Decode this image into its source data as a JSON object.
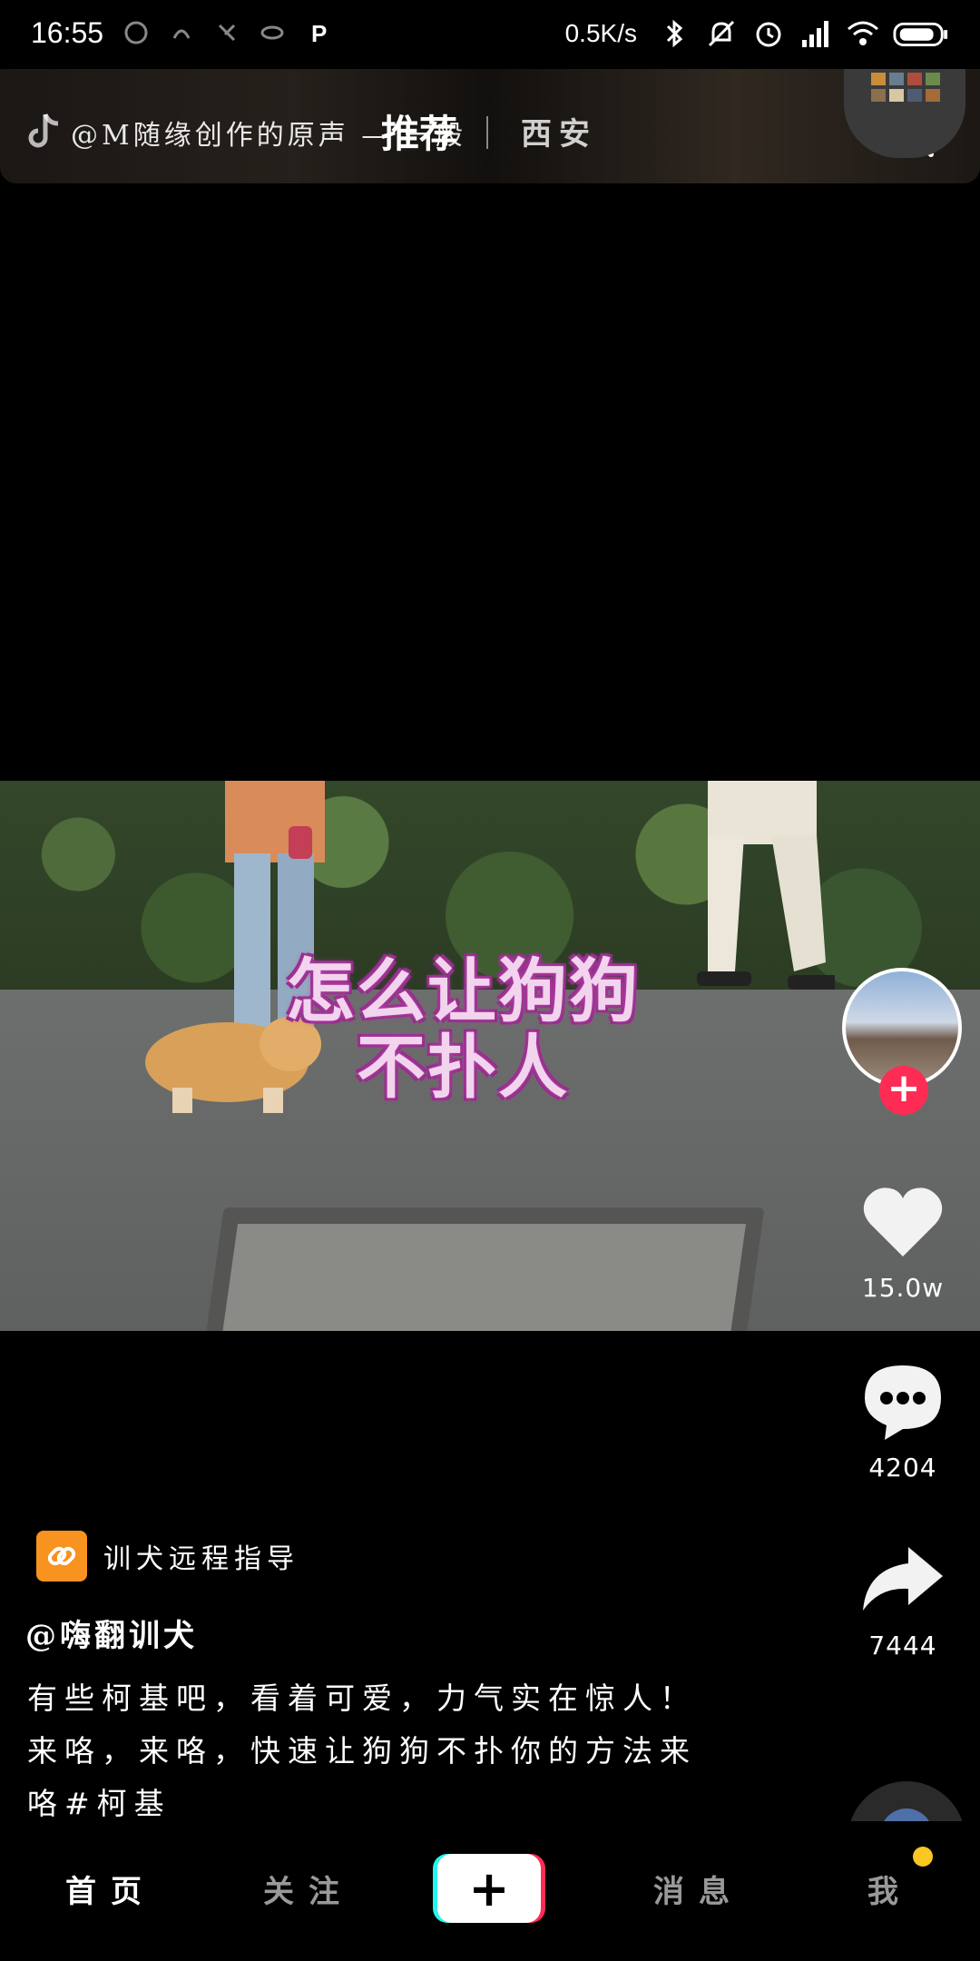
{
  "status_bar": {
    "time": "16:55",
    "net_speed": "0.5K/s",
    "icons": [
      "bluetooth-icon",
      "mute-icon",
      "alarm-icon",
      "signal-icon",
      "wifi-icon",
      "battery-icon"
    ]
  },
  "top_bar": {
    "overlay_music_text": "@M随缘创作的原声 — 一般",
    "tab_recommend": "推荐",
    "tab_city": "西安"
  },
  "video": {
    "caption_line1": "怎么让狗狗",
    "caption_line2": "不扑人"
  },
  "actions": {
    "like_count": "15.0w",
    "comment_count": "4204",
    "share_count": "7444"
  },
  "info": {
    "promo_label": "训犬远程指导",
    "username": "@嗨翻训犬",
    "description_line1": "有些柯基吧，看着可爱，力气实在惊人！",
    "description_line2": "来咯，来咯，快速让狗狗不扑你的方法来",
    "description_line3": "咯#柯基"
  },
  "bottom_nav": {
    "home": "首页",
    "follow": "关注",
    "create": "+",
    "inbox": "消息",
    "me": "我"
  },
  "colors": {
    "accent_red": "#fe2c55",
    "accent_cyan": "#25f4ee",
    "promo_orange": "#f7931e",
    "notification_dot": "#f9c623"
  }
}
